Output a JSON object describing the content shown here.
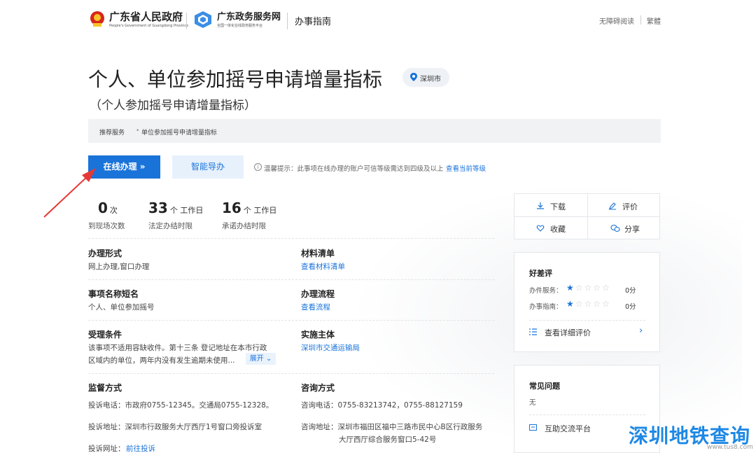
{
  "header": {
    "gov_name": "广东省人民政府",
    "gov_en": "People's Government of Guangdong Province",
    "service_name": "广东政务服务网",
    "service_sub": "全国一体化在线政务服务平台",
    "guide": "办事指南",
    "accessibility": "无障碍阅读",
    "traditional": "繁體"
  },
  "page": {
    "title": "个人、单位参加摇号申请增量指标",
    "location": "深圳市",
    "subtitle": "（个人参加摇号申请增量指标）"
  },
  "breadcrumb": {
    "items": [
      "推荐服务",
      "单位参加摇号申请增量指标"
    ],
    "separator": "•"
  },
  "buttons": {
    "online": "在线办理 »",
    "smart_guide": "智能导办"
  },
  "tip": {
    "icon": "i",
    "text": "温馨提示：此事项在线办理的账户可信等级需达到四级及以上",
    "link": "查看当前等级"
  },
  "stats": [
    {
      "number": "0",
      "unit": "次",
      "label": "到现场次数"
    },
    {
      "number": "33",
      "unit": "个 工作日",
      "label": "法定办结时限"
    },
    {
      "number": "16",
      "unit": "个 工作日",
      "label": "承诺办结时限"
    }
  ],
  "fields": {
    "form_label": "办理形式",
    "form_value": "网上办理,窗口办理",
    "materials_label": "材料清单",
    "materials_link": "查看材料清单",
    "short_name_label": "事项名称短名",
    "short_name_value": "个人、单位参加摇号",
    "process_label": "办理流程",
    "process_link": "查看流程",
    "conditions_label": "受理条件",
    "conditions_line1": "该事项不适用容缺收件。第十三条   登记地址在本市行政",
    "conditions_line2": "区域内的单位，两年内没有发生逾期未使用...",
    "expand": "展开",
    "agency_label": "实施主体",
    "agency_link": "深圳市交通运输局",
    "supervision_label": "监督方式",
    "complaint_phone": "投诉电话：市政府0755-12345。交通局0755-12328。",
    "complaint_address": "投诉地址：深圳市行政服务大厅西厅1号窗口旁投诉室",
    "complaint_url_label": "投诉网址：",
    "complaint_url_link": "前往投诉",
    "consult_label": "咨询方式",
    "consult_phone": "咨询电话：0755-83213742，0755-88127159",
    "consult_address_line1": "咨询地址：深圳市福田区福中三路市民中心B区行政服务",
    "consult_address_line2": "大厅西厅综合服务窗口5-42号"
  },
  "actions": {
    "download": "下载",
    "evaluate": "评价",
    "favorite": "收藏",
    "share": "分享"
  },
  "rating": {
    "title": "好差评",
    "service_label": "办件服务：",
    "service_score": "0分",
    "guide_label": "办事指南：",
    "guide_score": "0分",
    "stars_filled": 1,
    "stars_total": 5,
    "detail_link": "查看详细评价"
  },
  "faq": {
    "title": "常见问题",
    "content": "无",
    "link": "互助交流平台"
  },
  "watermark": {
    "text": "深圳地铁查询",
    "url": "www.tus8.com"
  },
  "colors": {
    "accent": "#1a73d9",
    "annotation_arrow": "#e53935"
  }
}
